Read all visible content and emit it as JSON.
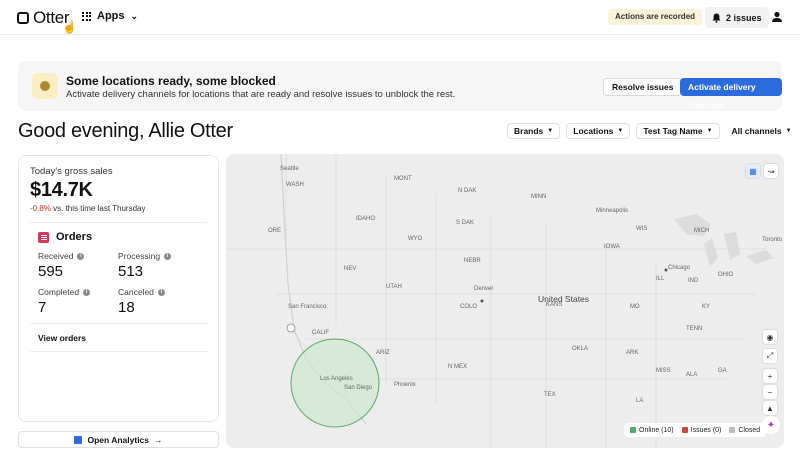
{
  "topbar": {
    "brand": "Otter",
    "apps_label": "Apps",
    "recorded_badge": "Actions are recorded",
    "issues_label": "2 issues"
  },
  "banner": {
    "title": "Some locations ready, some blocked",
    "subtitle": "Activate delivery channels for locations that are ready and resolve issues to unblock the rest.",
    "resolve_label": "Resolve issues",
    "activate_label": "Activate delivery channels"
  },
  "greeting": "Good evening, Allie Otter",
  "filters": [
    {
      "label": "Brands"
    },
    {
      "label": "Locations"
    },
    {
      "label": "Test Tag Name"
    },
    {
      "label": "All channels"
    }
  ],
  "sales": {
    "label": "Today's gross sales",
    "value": "$14.7K",
    "delta": "-0.8%",
    "delta_text": "vs. this time last Thursday"
  },
  "orders": {
    "title": "Orders",
    "received_label": "Received",
    "received_value": "595",
    "processing_label": "Processing",
    "processing_value": "513",
    "completed_label": "Completed",
    "completed_value": "7",
    "canceled_label": "Canceled",
    "canceled_value": "18",
    "view_label": "View orders"
  },
  "analytics_label": "Open Analytics",
  "map": {
    "labels": {
      "seattle": "Seattle",
      "minneapolis": "Minneapolis",
      "toronto": "Toronto",
      "chicago": "Chicago",
      "denver": "Denver",
      "united_states": "United States",
      "san_francisco": "San Francisco",
      "los_angeles": "Los Angeles",
      "san_diego": "San Diego",
      "phoenix": "Phoenix",
      "calif": "CALIF",
      "nev": "NEV",
      "ariz": "ARIZ",
      "utah": "UTAH",
      "colo": "COLO",
      "kans": "KANS",
      "mo": "MO",
      "iowa": "IOWA",
      "wis": "WIS",
      "mich": "MICH",
      "ohio": "OHIO",
      "ind": "IND",
      "ill": "ILL",
      "ky": "KY",
      "tenn": "TENN",
      "ark": "ARK",
      "okla": "OKLA",
      "tex": "TEX",
      "n_mex": "N MEX",
      "wyo": "WYO",
      "idaho": "IDAHO",
      "mont": "MONT",
      "n_dak": "N DAK",
      "s_dak": "S DAK",
      "nebr": "NEBR",
      "minn": "MINN",
      "ore": "ORE",
      "wash": "WASH",
      "miss": "MISS",
      "ala": "ALA",
      "la": "LA",
      "ga": "GA"
    },
    "legend": {
      "online": "Online (10)",
      "issues": "Issues (0)",
      "closed": "Closed"
    },
    "colors": {
      "online": "#5aa86a",
      "issues": "#d64545",
      "closed": "#bdbdbd",
      "radius_fill": "#cfe8cf",
      "radius_stroke": "#5aa86a"
    }
  }
}
